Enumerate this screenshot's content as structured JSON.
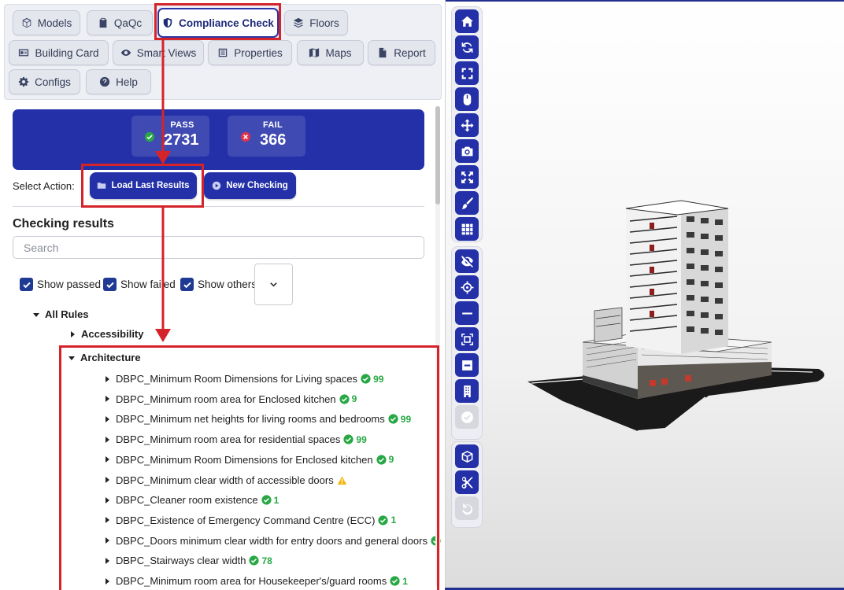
{
  "tabs": [
    {
      "label": "Models",
      "icon": "cube-icon"
    },
    {
      "label": "QaQc",
      "icon": "clipboard-check-icon"
    },
    {
      "label": "Compliance Check",
      "icon": "shield-icon",
      "active": true
    },
    {
      "label": "Floors",
      "icon": "layers-icon"
    },
    {
      "label": "Building Card",
      "icon": "id-card-icon"
    },
    {
      "label": "Smart Views",
      "icon": "eye-icon"
    },
    {
      "label": "Properties",
      "icon": "list-icon"
    },
    {
      "label": "Maps",
      "icon": "map-icon"
    },
    {
      "label": "Report",
      "icon": "file-icon"
    },
    {
      "label": "Configs",
      "icon": "gear-icon"
    },
    {
      "label": "Help",
      "icon": "question-circle-icon"
    }
  ],
  "stats": {
    "pass_label": "PASS",
    "pass_value": "2731",
    "fail_label": "FAIL",
    "fail_value": "366"
  },
  "actions": {
    "select_label": "Select Action:",
    "load_last": "Load Last Results",
    "new_checking": "New Checking"
  },
  "results": {
    "heading": "Checking results",
    "search_placeholder": "Search",
    "filters": [
      "Show passed",
      "Show failed",
      "Show others"
    ],
    "root": "All Rules",
    "groups": [
      "Accessibility",
      "Architecture"
    ],
    "rules": [
      {
        "name": "DBPC_Minimum Room Dimensions for Living spaces",
        "status": "pass",
        "count": "99"
      },
      {
        "name": "DBPC_Minimum room area for Enclosed kitchen",
        "status": "pass",
        "count": "9"
      },
      {
        "name": "DBPC_Minimum net heights for living rooms and bedrooms",
        "status": "pass",
        "count": "99"
      },
      {
        "name": "DBPC_Minimum room area for residential spaces",
        "status": "pass",
        "count": "99"
      },
      {
        "name": "DBPC_Minimum Room Dimensions for Enclosed kitchen",
        "status": "pass",
        "count": "9"
      },
      {
        "name": "DBPC_Minimum clear width of accessible doors",
        "status": "warning",
        "count": ""
      },
      {
        "name": "DBPC_Cleaner room existence",
        "status": "pass",
        "count": "1"
      },
      {
        "name": "DBPC_Existence of Emergency Command Centre (ECC)",
        "status": "pass",
        "count": "1"
      },
      {
        "name": "DBPC_Doors minimum clear width for entry doors and general doors",
        "status": "pass",
        "count": ""
      },
      {
        "name": "DBPC_Stairways clear width",
        "status": "pass",
        "count": "78"
      },
      {
        "name": "DBPC_Minimum room area for Housekeeper's/guard rooms",
        "status": "pass",
        "count": "1"
      }
    ]
  },
  "viewer_toolbar": {
    "group1": [
      "home-icon",
      "refresh-icon",
      "fullscreen-icon",
      "mouse-icon",
      "move-icon",
      "camera-icon",
      "expand-icon",
      "brush-icon",
      "grid-icon"
    ],
    "group2": [
      "eye-slash-icon",
      "crosshair-icon",
      "minus-icon",
      "section-box-icon",
      "minus-square-icon",
      "building-icon",
      "check-circle-icon"
    ],
    "group3": [
      "cube-icon",
      "scissors-icon",
      "undo-icon"
    ]
  },
  "colors": {
    "primary": "#2330a8",
    "pass": "#27a844",
    "fail": "#e0334c",
    "warning": "#f5b50a",
    "annotation": "#d5232a"
  }
}
